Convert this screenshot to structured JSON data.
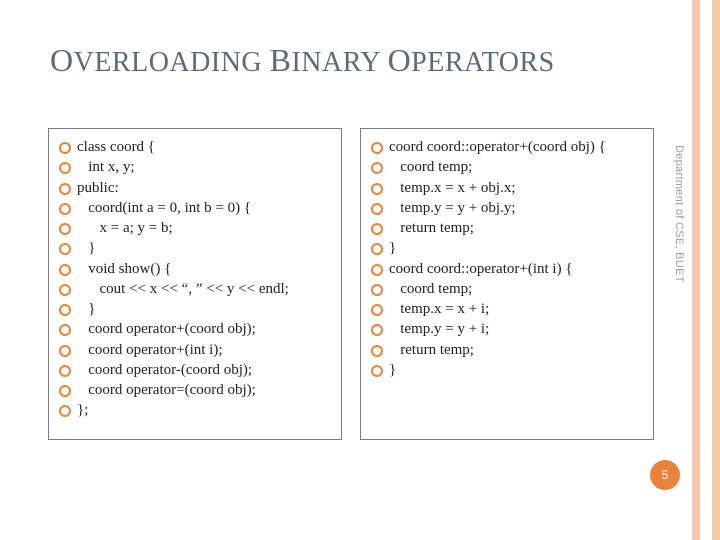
{
  "title": {
    "word1_lead": "O",
    "word1_rest": "VERLOADING",
    "word2_lead": "B",
    "word2_rest": "INARY",
    "word3_lead": "O",
    "word3_rest": "PERATORS"
  },
  "left_box": {
    "lines": [
      "class coord {",
      "   int x, y;",
      "public:",
      "   coord(int a = 0, int b = 0) {",
      "      x = a; y = b;",
      "   }",
      "   void show() {",
      "      cout << x << “, ” << y << endl;",
      "   }",
      "   coord operator+(coord obj);",
      "   coord operator+(int i);",
      "   coord operator-(coord obj);",
      "   coord operator=(coord obj);",
      "};"
    ]
  },
  "right_box": {
    "lines": [
      "coord coord::operator+(coord obj) {",
      "   coord temp;",
      "   temp.x = x + obj.x;",
      "   temp.y = y + obj.y;",
      "   return temp;",
      "}",
      "coord coord::operator+(int i) {",
      "   coord temp;",
      "   temp.x = x + i;",
      "   temp.y = y + i;",
      "   return temp;",
      "}"
    ]
  },
  "side_label": "Department of CSE, BUET",
  "page_number": "5"
}
